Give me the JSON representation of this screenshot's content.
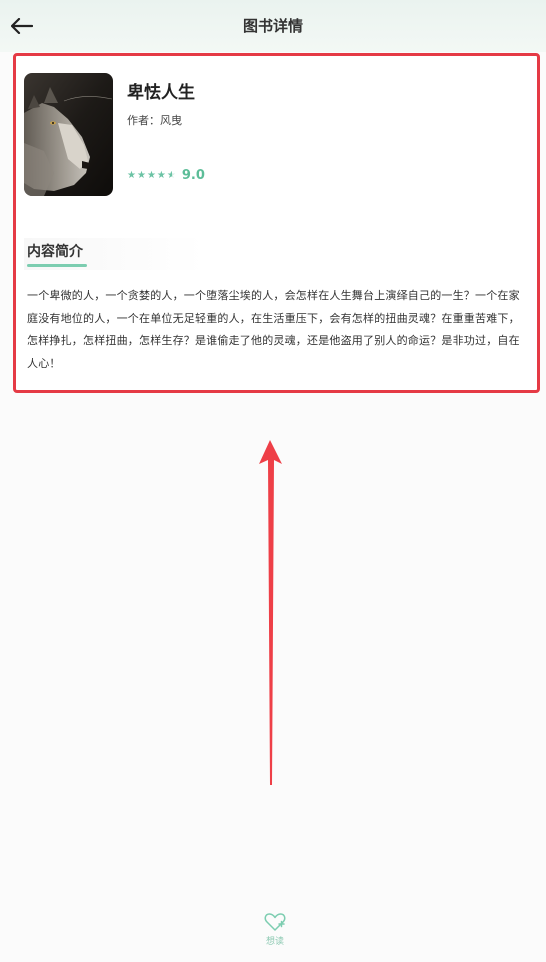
{
  "header": {
    "title": "图书详情",
    "back_icon": "arrow-left-icon"
  },
  "book": {
    "title": "卑怯人生",
    "author": "作者：风曳",
    "rating": 9.0,
    "rating_text": "9.0",
    "stars": 4.5,
    "cover_icon": "wolf-image"
  },
  "synopsis": {
    "heading": "内容简介",
    "text": "一个卑微的人，一个贪婪的人，一个堕落尘埃的人，会怎样在人生舞台上演绎自己的一生？一个在家庭没有地位的人，一个在单位无足轻重的人，在生活重压下，会有怎样的扭曲灵魂？在重重苦难下，怎样挣扎，怎样扭曲，怎样生存？是谁偷走了他的灵魂，还是他盗用了别人的命运？是非功过，自在人心！"
  },
  "bottom_bar": {
    "want_read_label": "想读",
    "want_read_icon": "heart-plus-icon"
  },
  "colors": {
    "accent": "#6cc3a5",
    "highlight_border": "#e53a45",
    "arrow": "#ee3f47"
  }
}
